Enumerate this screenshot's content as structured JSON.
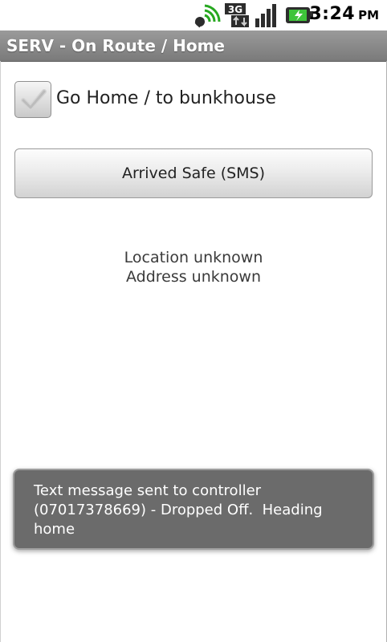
{
  "status_bar": {
    "network_label": "3G",
    "time": "3:24",
    "ampm": "PM",
    "icons": [
      "gps-signal-icon",
      "3g-data-icon",
      "signal-strength-icon",
      "battery-charging-icon"
    ]
  },
  "app": {
    "title": "SERV - On Route / Home"
  },
  "checkbox": {
    "label": "Go Home / to bunkhouse",
    "checked": true
  },
  "button": {
    "label": "Arrived Safe (SMS)"
  },
  "location": {
    "line1": "Location unknown",
    "line2": "Address unknown"
  },
  "toast": {
    "line1": "Text message sent to controller",
    "line2": "(07017378669) - Dropped Off.  Heading",
    "line3": "home"
  }
}
